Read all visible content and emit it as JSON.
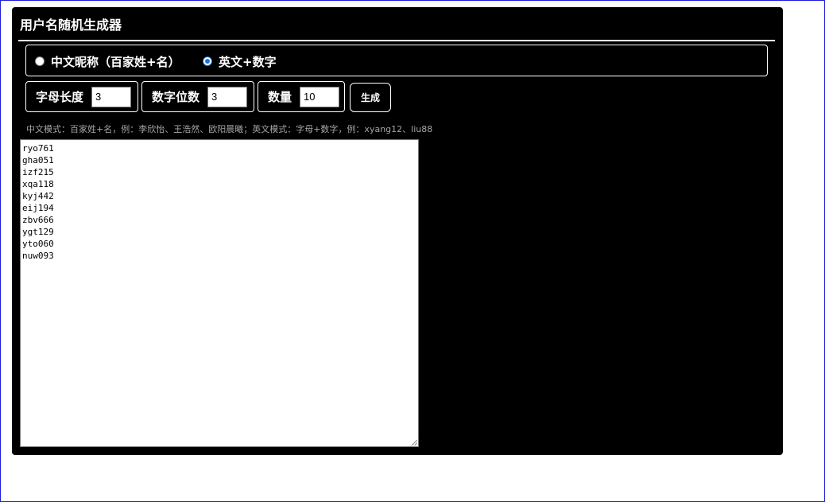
{
  "app": {
    "title": "用户名随机生成器"
  },
  "mode": {
    "options": [
      {
        "label": "中文昵称（百家姓+名）",
        "selected": false
      },
      {
        "label": "英文+数字",
        "selected": true
      }
    ]
  },
  "fields": {
    "letter_length": {
      "label": "字母长度",
      "value": "3"
    },
    "digit_count": {
      "label": "数字位数",
      "value": "3"
    },
    "quantity": {
      "label": "数量",
      "value": "10"
    }
  },
  "actions": {
    "generate_label": "生成"
  },
  "hint": "中文模式：百家姓+名，例：李欣怡、王浩然、欧阳晨曦；英文模式：字母+数字，例：xyang12、liu88",
  "output": {
    "lines": [
      "ryo761",
      "gha051",
      "izf215",
      "xqa118",
      "kyj442",
      "eij194",
      "zbv666",
      "ygt129",
      "yto060",
      "nuw093"
    ]
  },
  "colors": {
    "panel_bg": "#000000",
    "accent": "#1a73e8",
    "frame": "#1d1dd6",
    "hint_text": "#a6a6a6"
  }
}
